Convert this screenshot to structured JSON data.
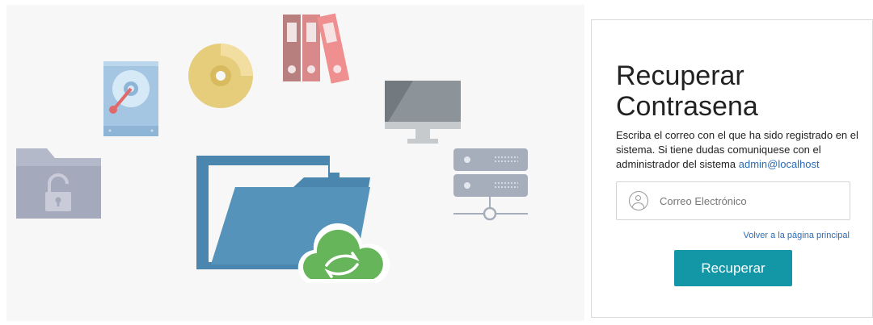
{
  "form": {
    "title_line1": "Recuperar",
    "title_line2": "Contrasena",
    "description": "Escriba el correo con el que ha sido registrado en el sistema. Si tiene dudas comuniquese con el administrador del sistema ",
    "admin_email": "admin@localhost",
    "email_placeholder": "Correo Electrónico",
    "email_value": "",
    "back_link": "Volver a la página principal",
    "submit_label": "Recuperar"
  },
  "colors": {
    "accent": "#1396a6",
    "link": "#2a6cb5",
    "folder_blue": "#4a86ad",
    "cloud_green": "#67b55a"
  },
  "illustration": {
    "icons": [
      "hard-drive-icon",
      "cd-disc-icon",
      "binders-icon",
      "monitor-icon",
      "server-icon",
      "locked-folder-icon",
      "open-folder-icon",
      "cloud-sync-icon"
    ]
  }
}
